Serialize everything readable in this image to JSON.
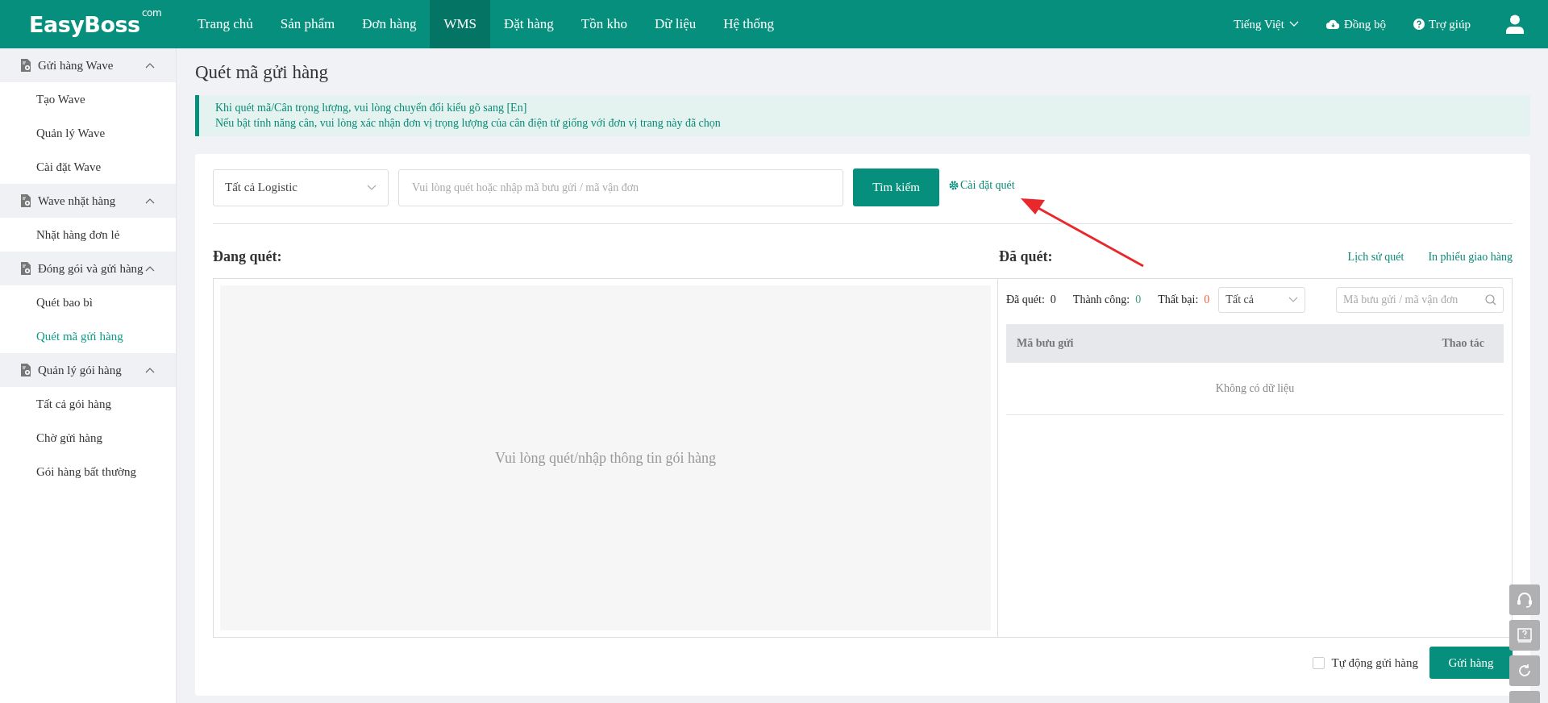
{
  "header": {
    "logo": "EasyBoss",
    "logo_suffix": "com",
    "nav": [
      {
        "label": "Trang chủ",
        "selected": false
      },
      {
        "label": "Sản phẩm",
        "selected": false
      },
      {
        "label": "Đơn hàng",
        "selected": false
      },
      {
        "label": "WMS",
        "selected": true
      },
      {
        "label": "Đặt hàng",
        "selected": false
      },
      {
        "label": "Tồn kho",
        "selected": false
      },
      {
        "label": "Dữ liệu",
        "selected": false
      },
      {
        "label": "Hệ thống",
        "selected": false
      }
    ],
    "language": "Tiếng Việt",
    "sync": "Đồng bộ",
    "help": "Trợ giúp"
  },
  "sidebar": {
    "groups": [
      {
        "label": "Gửi hàng Wave",
        "expanded": true,
        "children": [
          {
            "label": "Tạo Wave",
            "selected": false
          },
          {
            "label": "Quản lý Wave",
            "selected": false
          },
          {
            "label": "Cài đặt Wave",
            "selected": false
          }
        ]
      },
      {
        "label": "Wave nhặt hàng",
        "expanded": true,
        "children": [
          {
            "label": "Nhặt hàng đơn lẻ",
            "selected": false
          }
        ]
      },
      {
        "label": "Đóng gói và gửi hàng",
        "expanded": true,
        "children": [
          {
            "label": "Quét bao bì",
            "selected": false
          },
          {
            "label": "Quét mã gửi hàng",
            "selected": true
          }
        ]
      },
      {
        "label": "Quản lý gói hàng",
        "expanded": true,
        "children": [
          {
            "label": "Tất cả gói hàng",
            "selected": false
          },
          {
            "label": "Chờ gửi hàng",
            "selected": false
          },
          {
            "label": "Gói hàng bất thường",
            "selected": false
          }
        ]
      }
    ]
  },
  "page": {
    "title": "Quét mã gửi hàng",
    "notice": [
      "Khi quét mã/Cân trọng lượng, vui lòng chuyển đổi kiểu gõ sang [En]",
      "Nếu bật tính năng cân, vui lòng xác nhận đơn vị trọng lượng của cân điện tử giống với đơn vị trang này đã chọn"
    ],
    "logistics_select": "Tất cả Logistic",
    "scan_input": {
      "placeholder": "Vui lòng quét hoặc nhập mã bưu gửi / mã vận đơn"
    },
    "search_button": "Tìm kiếm",
    "scan_settings": "Cài đặt quét",
    "scanning": {
      "title": "Đang quét:",
      "empty": "Vui lòng quét/nhập thông tin gói hàng"
    },
    "scanned": {
      "title": "Đã quét:",
      "links": [
        "Lịch sử quét",
        "In phiếu giao hàng"
      ],
      "stats": [
        {
          "label": "Đã quét:",
          "value": "0",
          "kind": "neutral"
        },
        {
          "label": "Thành công:",
          "value": "0",
          "kind": "success"
        },
        {
          "label": "Thất bại:",
          "value": "0",
          "kind": "fail"
        }
      ],
      "status_select": "Tất cả",
      "search": {
        "placeholder": "Mã bưu gửi / mã vận đơn"
      },
      "table": {
        "columns": [
          "Mã bưu gửi",
          "Thao tác"
        ],
        "empty": "Không có dữ liệu"
      }
    },
    "auto_send": {
      "label": "Tự động gửi hàng",
      "checked": false
    },
    "send_button": "Gửi hàng"
  }
}
